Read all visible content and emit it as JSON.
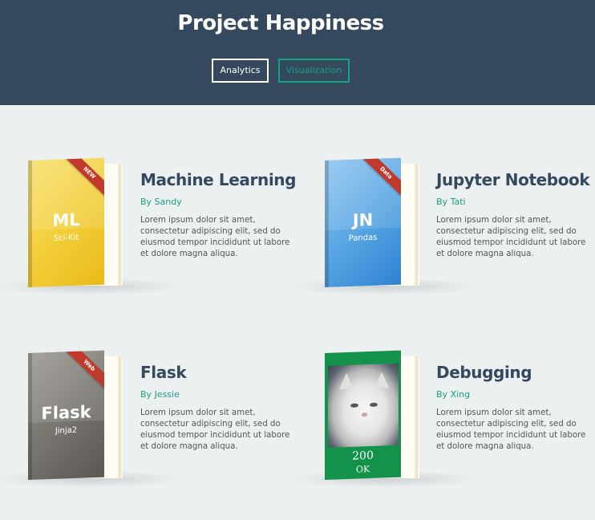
{
  "header": {
    "title": "Project Happiness",
    "buttons": {
      "analytics": "Analytics",
      "visualization": "Visualization"
    }
  },
  "colors": {
    "header_bg": "#34495e",
    "accent": "#16a085",
    "page_bg": "#ecf0f1",
    "ribbon": "#c0392b"
  },
  "books": [
    {
      "title": "Machine Learning",
      "by": "By",
      "author": "Sandy",
      "cover_abbr": "ML",
      "cover_sub": "Sci-Kit",
      "ribbon": "NEW",
      "cover_color": "yellow",
      "description": "Lorem ipsum dolor sit amet, consectetur adipiscing elit, sed do eiusmod tempor incididunt ut labore et dolore magna aliqua."
    },
    {
      "title": "Jupyter Notebook",
      "by": "By",
      "author": "Tati",
      "cover_abbr": "JN",
      "cover_sub": "Pandas",
      "ribbon": "Data",
      "cover_color": "blue",
      "description": "Lorem ipsum dolor sit amet, consectetur adipiscing elit, sed do eiusmod tempor incididunt ut labore et dolore magna aliqua."
    },
    {
      "title": "Flask",
      "by": "By",
      "author": "Jessie",
      "cover_abbr": "Flask",
      "cover_sub": "Jinja2",
      "ribbon": "Web",
      "cover_color": "gray",
      "description": "Lorem ipsum dolor sit amet, consectetur adipiscing elit, sed do eiusmod tempor incididunt ut labore et dolore magna aliqua."
    },
    {
      "title": "Debugging",
      "by": "By",
      "author": "Xing",
      "cover_code": "200",
      "cover_code_text": "OK",
      "cover_image": "cat-photo",
      "cover_color": "green",
      "description": "Lorem ipsum dolor sit amet, consectetur adipiscing elit, sed do eiusmod tempor incididunt ut labore et dolore magna aliqua."
    }
  ]
}
